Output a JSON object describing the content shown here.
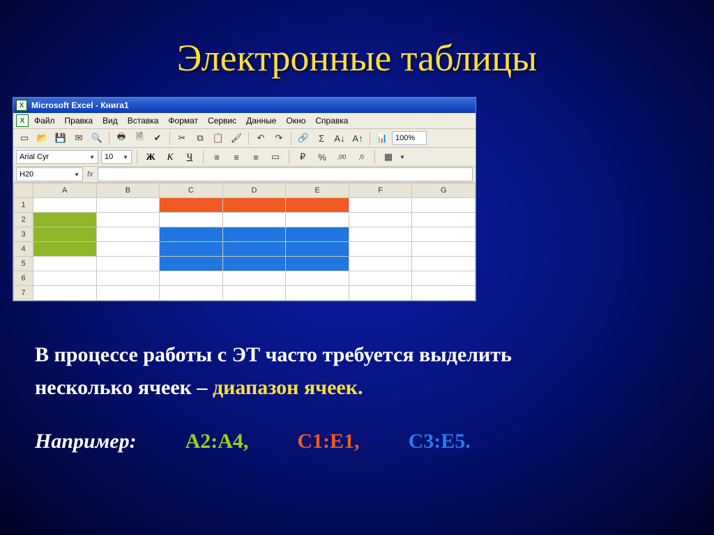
{
  "slide": {
    "title": "Электронные таблицы"
  },
  "excel": {
    "titlebar": "Microsoft Excel - Книга1",
    "menu": {
      "file": "Файл",
      "edit": "Правка",
      "view": "Вид",
      "insert": "Вставка",
      "format": "Формат",
      "tools": "Сервис",
      "data": "Данные",
      "window": "Окно",
      "help": "Справка"
    },
    "toolbar": {
      "zoom": "100%"
    },
    "format_bar": {
      "font": "Arial Cyr",
      "size": "10",
      "bold": "Ж",
      "italic": "К",
      "underline": "Ч",
      "inc_dec_a": "%",
      "dec1": ",00",
      "dec2": ",0"
    },
    "formula_bar": {
      "name_box": "H20",
      "fx": "fx"
    },
    "columns": [
      "A",
      "B",
      "C",
      "D",
      "E",
      "F",
      "G"
    ],
    "rows": [
      "1",
      "2",
      "3",
      "4",
      "5",
      "6",
      "7"
    ],
    "ranges": {
      "green": [
        "A2",
        "A3",
        "A4"
      ],
      "orange": [
        "C1",
        "D1",
        "E1"
      ],
      "blue": [
        "C3",
        "D3",
        "E3",
        "C4",
        "D4",
        "E4",
        "C5",
        "D5",
        "E5"
      ]
    }
  },
  "body": {
    "line1": "В процессе работы с ЭТ часто требуется выделить",
    "line2a": "несколько ячеек – ",
    "line2b": "диапазон ячеек."
  },
  "examples": {
    "label": "Например:",
    "r1": "A2:A4,",
    "r2": "C1:E1,",
    "r3": "C3:E5."
  }
}
